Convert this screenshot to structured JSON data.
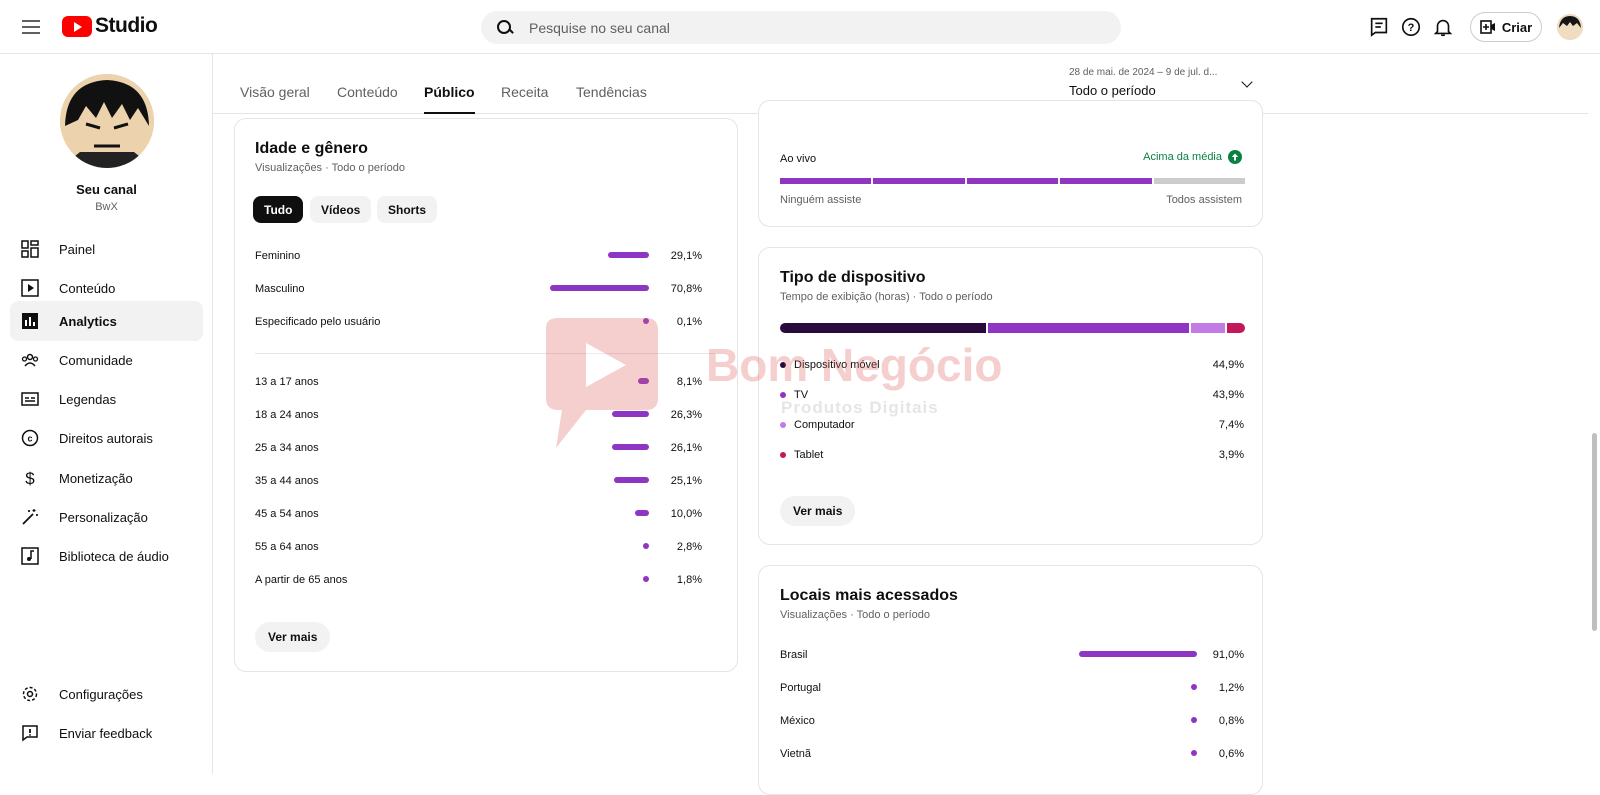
{
  "header": {
    "logo_text": "Studio",
    "search_placeholder": "Pesquise no seu canal",
    "create_label": "Criar"
  },
  "sidebar": {
    "channel_name": "Seu canal",
    "channel_handle": "BwX",
    "items": [
      {
        "label": "Painel",
        "icon": "dashboard-icon"
      },
      {
        "label": "Conteúdo",
        "icon": "content-icon"
      },
      {
        "label": "Analytics",
        "icon": "analytics-icon",
        "active": true
      },
      {
        "label": "Comunidade",
        "icon": "community-icon"
      },
      {
        "label": "Legendas",
        "icon": "subtitles-icon"
      },
      {
        "label": "Direitos autorais",
        "icon": "copyright-icon"
      },
      {
        "label": "Monetização",
        "icon": "dollar-icon"
      },
      {
        "label": "Personalização",
        "icon": "magic-wand-icon"
      },
      {
        "label": "Biblioteca de áudio",
        "icon": "audio-library-icon"
      }
    ],
    "bottom_items": [
      {
        "label": "Configurações",
        "icon": "gear-icon"
      },
      {
        "label": "Enviar feedback",
        "icon": "feedback-icon"
      }
    ]
  },
  "tabs": [
    {
      "label": "Visão geral"
    },
    {
      "label": "Conteúdo"
    },
    {
      "label": "Público",
      "active": true
    },
    {
      "label": "Receita"
    },
    {
      "label": "Tendências"
    }
  ],
  "period": {
    "range": "28 de mai. de 2024 – 9 de jul. d...",
    "label": "Todo o período"
  },
  "age_gender": {
    "title": "Idade e gênero",
    "subtitle": "Visualizações · Todo o período",
    "chips": [
      {
        "label": "Tudo",
        "active": true
      },
      {
        "label": "Vídeos"
      },
      {
        "label": "Shorts"
      }
    ],
    "gender": [
      {
        "label": "Feminino",
        "value": "29,1%",
        "pct": 29.1
      },
      {
        "label": "Masculino",
        "value": "70,8%",
        "pct": 70.8
      },
      {
        "label": "Especificado pelo usuário",
        "value": "0,1%",
        "pct": 0.1
      }
    ],
    "ages": [
      {
        "label": "13 a 17 anos",
        "value": "8,1%",
        "pct": 8.1
      },
      {
        "label": "18 a 24 anos",
        "value": "26,3%",
        "pct": 26.3
      },
      {
        "label": "25 a 34 anos",
        "value": "26,1%",
        "pct": 26.1
      },
      {
        "label": "35 a 44 anos",
        "value": "25,1%",
        "pct": 25.1
      },
      {
        "label": "45 a 54 anos",
        "value": "10,0%",
        "pct": 10.0
      },
      {
        "label": "55 a 64 anos",
        "value": "2,8%",
        "pct": 2.8
      },
      {
        "label": "A partir de 65 anos",
        "value": "1,8%",
        "pct": 1.8
      }
    ],
    "more_label": "Ver mais"
  },
  "live": {
    "label": "Ao vivo",
    "status": "Acima da média",
    "min_label": "Ninguém assiste",
    "max_label": "Todos assistem",
    "filled_segments": 4,
    "total_segments": 5
  },
  "device": {
    "title": "Tipo de dispositivo",
    "subtitle": "Tempo de exibição (horas) · Todo o período",
    "items": [
      {
        "label": "Dispositivo móvel",
        "value": "44,9%",
        "pct": 44.9,
        "color": "#2a0a3d"
      },
      {
        "label": "TV",
        "value": "43,9%",
        "pct": 43.9,
        "color": "#8e36c3"
      },
      {
        "label": "Computador",
        "value": "7,4%",
        "pct": 7.4,
        "color": "#c27be5"
      },
      {
        "label": "Tablet",
        "value": "3,9%",
        "pct": 3.9,
        "color": "#c2185b"
      }
    ],
    "more_label": "Ver mais"
  },
  "locations": {
    "title": "Locais mais acessados",
    "subtitle": "Visualizações · Todo o período",
    "items": [
      {
        "label": "Brasil",
        "value": "91,0%",
        "pct": 91.0
      },
      {
        "label": "Portugal",
        "value": "1,2%",
        "pct": 1.2
      },
      {
        "label": "México",
        "value": "0,8%",
        "pct": 0.8
      },
      {
        "label": "Vietnã",
        "value": "0,6%",
        "pct": 0.6
      }
    ]
  },
  "watermark": {
    "title": "Bom Negócio",
    "subtitle": "Produtos Digitais"
  },
  "colors": {
    "accent": "#8e36c3",
    "brand": "#ff0000",
    "positive": "#0b8043"
  }
}
